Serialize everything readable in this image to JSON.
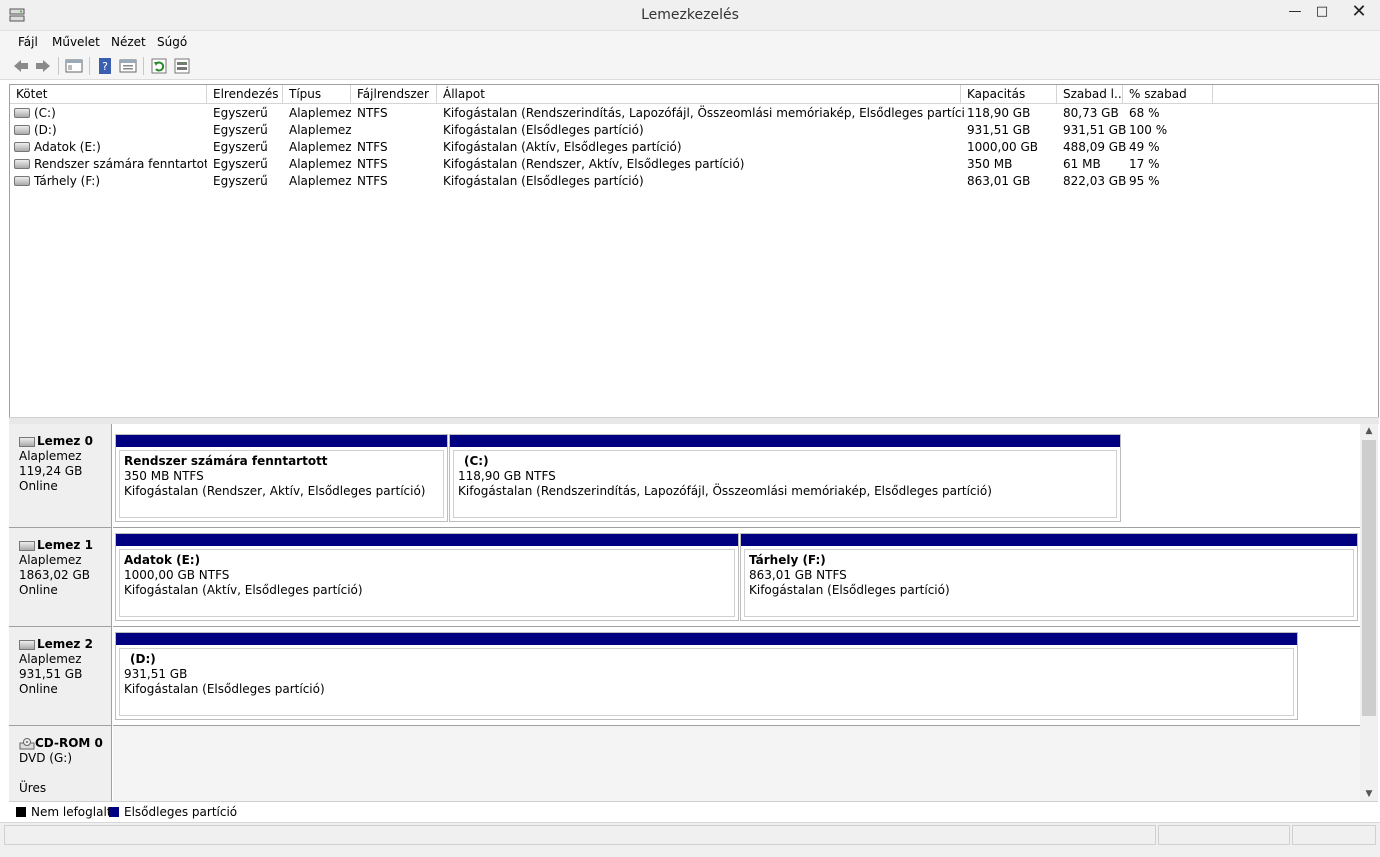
{
  "window": {
    "title": "Lemezkezelés",
    "minimize": "—",
    "maximize": "□",
    "close": "✕"
  },
  "menu": [
    "Fájl",
    "Művelet",
    "Nézet",
    "Súgó"
  ],
  "toolbar": [
    "back-icon",
    "forward-icon",
    "console-tree-icon",
    "help-icon",
    "properties-icon",
    "refresh-icon",
    "rescan-disks-icon"
  ],
  "volume_table": {
    "columns": [
      "Kötet",
      "Elrendezés",
      "Típus",
      "Fájlrendszer",
      "Állapot",
      "Kapacitás",
      "Szabad l...",
      "% szabad"
    ],
    "rows": [
      [
        "(C:)",
        "Egyszerű",
        "Alaplemez",
        "NTFS",
        "Kifogástalan (Rendszerindítás, Lapozófájl, Összeomlási memóriakép, Elsődleges partíció)",
        "118,90 GB",
        "80,73 GB",
        "68 %"
      ],
      [
        "(D:)",
        "Egyszerű",
        "Alaplemez",
        "",
        "Kifogástalan (Elsődleges partíció)",
        "931,51 GB",
        "931,51 GB",
        "100 %"
      ],
      [
        "Adatok (E:)",
        "Egyszerű",
        "Alaplemez",
        "NTFS",
        "Kifogástalan (Aktív, Elsődleges partíció)",
        "1000,00 GB",
        "488,09 GB",
        "49 %"
      ],
      [
        "Rendszer számára fenntartott",
        "Egyszerű",
        "Alaplemez",
        "NTFS",
        "Kifogástalan (Rendszer, Aktív, Elsődleges partíció)",
        "350 MB",
        "61 MB",
        "17 %"
      ],
      [
        "Tárhely (F:)",
        "Egyszerű",
        "Alaplemez",
        "NTFS",
        "Kifogástalan (Elsődleges partíció)",
        "863,01 GB",
        "822,03 GB",
        "95 %"
      ]
    ]
  },
  "disks": [
    {
      "name": "Lemez 0",
      "type": "Alaplemez",
      "size": "119,24 GB",
      "status": "Online",
      "partitions": [
        {
          "name": "Rendszer számára fenntartott",
          "size": "350 MB NTFS",
          "status": "Kifogástalan (Rendszer, Aktív, Elsődleges partíció)"
        },
        {
          "name": "(C:)",
          "size": "118,90 GB NTFS",
          "status": "Kifogástalan (Rendszerindítás, Lapozófájl, Összeomlási memóriakép, Elsődleges partíció)"
        }
      ]
    },
    {
      "name": "Lemez 1",
      "type": "Alaplemez",
      "size": "1863,02 GB",
      "status": "Online",
      "partitions": [
        {
          "name": "Adatok  (E:)",
          "size": "1000,00 GB NTFS",
          "status": "Kifogástalan (Aktív, Elsődleges partíció)"
        },
        {
          "name": "Tárhely  (F:)",
          "size": "863,01 GB NTFS",
          "status": "Kifogástalan (Elsődleges partíció)"
        }
      ]
    },
    {
      "name": "Lemez 2",
      "type": "Alaplemez",
      "size": "931,51 GB",
      "status": "Online",
      "partitions": [
        {
          "name": "(D:)",
          "size": "931,51 GB",
          "status": "Kifogástalan (Elsődleges partíció)"
        }
      ]
    },
    {
      "name": "CD-ROM 0",
      "type": "DVD (G:)",
      "status": "Üres"
    }
  ],
  "legend": [
    {
      "label": "Nem lefoglalt",
      "color": "#000000"
    },
    {
      "label": "Elsődleges partíció",
      "color": "#000080"
    }
  ],
  "colors": {
    "primary_partition": "#000080",
    "unallocated": "#000000"
  }
}
